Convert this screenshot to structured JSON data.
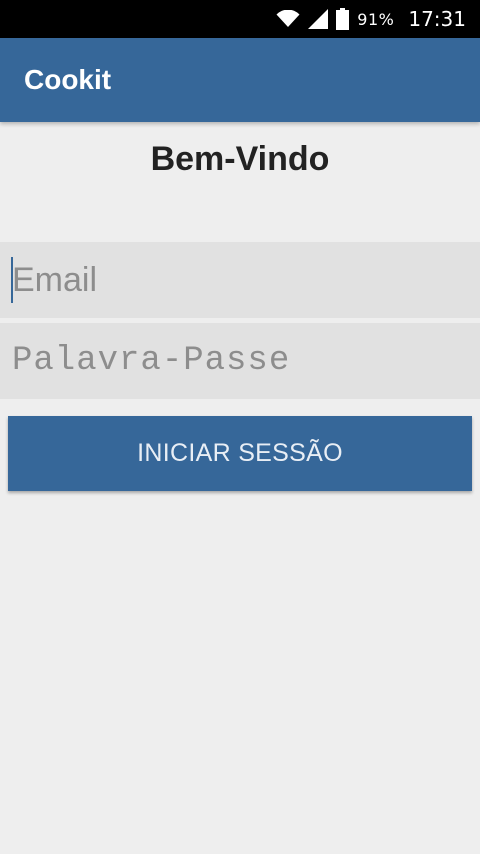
{
  "status_bar": {
    "battery_percent": "91%",
    "time": "17:31",
    "icons": [
      "wifi-icon",
      "signal-icon",
      "battery-icon"
    ]
  },
  "app_bar": {
    "title": "Cookit",
    "color": "#366799"
  },
  "login": {
    "welcome": "Bem-Vindo",
    "email_placeholder": "Email",
    "password_placeholder": "Palavra-Passe",
    "submit_label": "INICIAR SESSÃO"
  },
  "colors": {
    "primary": "#366799",
    "background": "#eeeeee",
    "field_background": "#e1e1e1"
  }
}
